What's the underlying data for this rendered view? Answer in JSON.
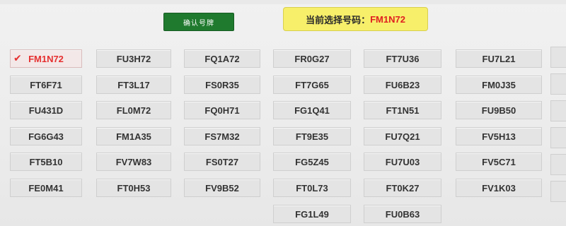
{
  "header": {
    "confirm_button": "确认号牌",
    "selected_label": "当前选择号码：",
    "selected_value": "FM1N72"
  },
  "plates": {
    "columns": [
      [
        "FM1N72",
        "FT6F71",
        "FU431D",
        "FG6G43",
        "FT5B10",
        "FE0M41"
      ],
      [
        "FU3H72",
        "FT3L17",
        "FL0M72",
        "FM1A35",
        "FV7W83",
        "FT0H53"
      ],
      [
        "FQ1A72",
        "FS0R35",
        "FQ0H71",
        "FS7M32",
        "FS0T27",
        "FV9B52"
      ],
      [
        "FR0G27",
        "FT7G65",
        "FG1Q41",
        "FT9E35",
        "FG5Z45",
        "FT0L73",
        "FG1L49"
      ],
      [
        "FT7U36",
        "FU6B23",
        "FT1N51",
        "FU7Q21",
        "FU7U03",
        "FT0K27",
        "FU0B63"
      ],
      [
        "FU7L21",
        "FM0J35",
        "FU9B50",
        "FV5H13",
        "FV5C71",
        "FV1K03"
      ]
    ],
    "selected": "FM1N72"
  },
  "icons": {
    "selected_marker": "check-icon"
  },
  "colors": {
    "confirm_button_bg": "#1f7a2e",
    "selected_panel_bg": "#f7ef6a",
    "selected_text": "#e02020",
    "plate_bg": "#e4e4e4"
  }
}
